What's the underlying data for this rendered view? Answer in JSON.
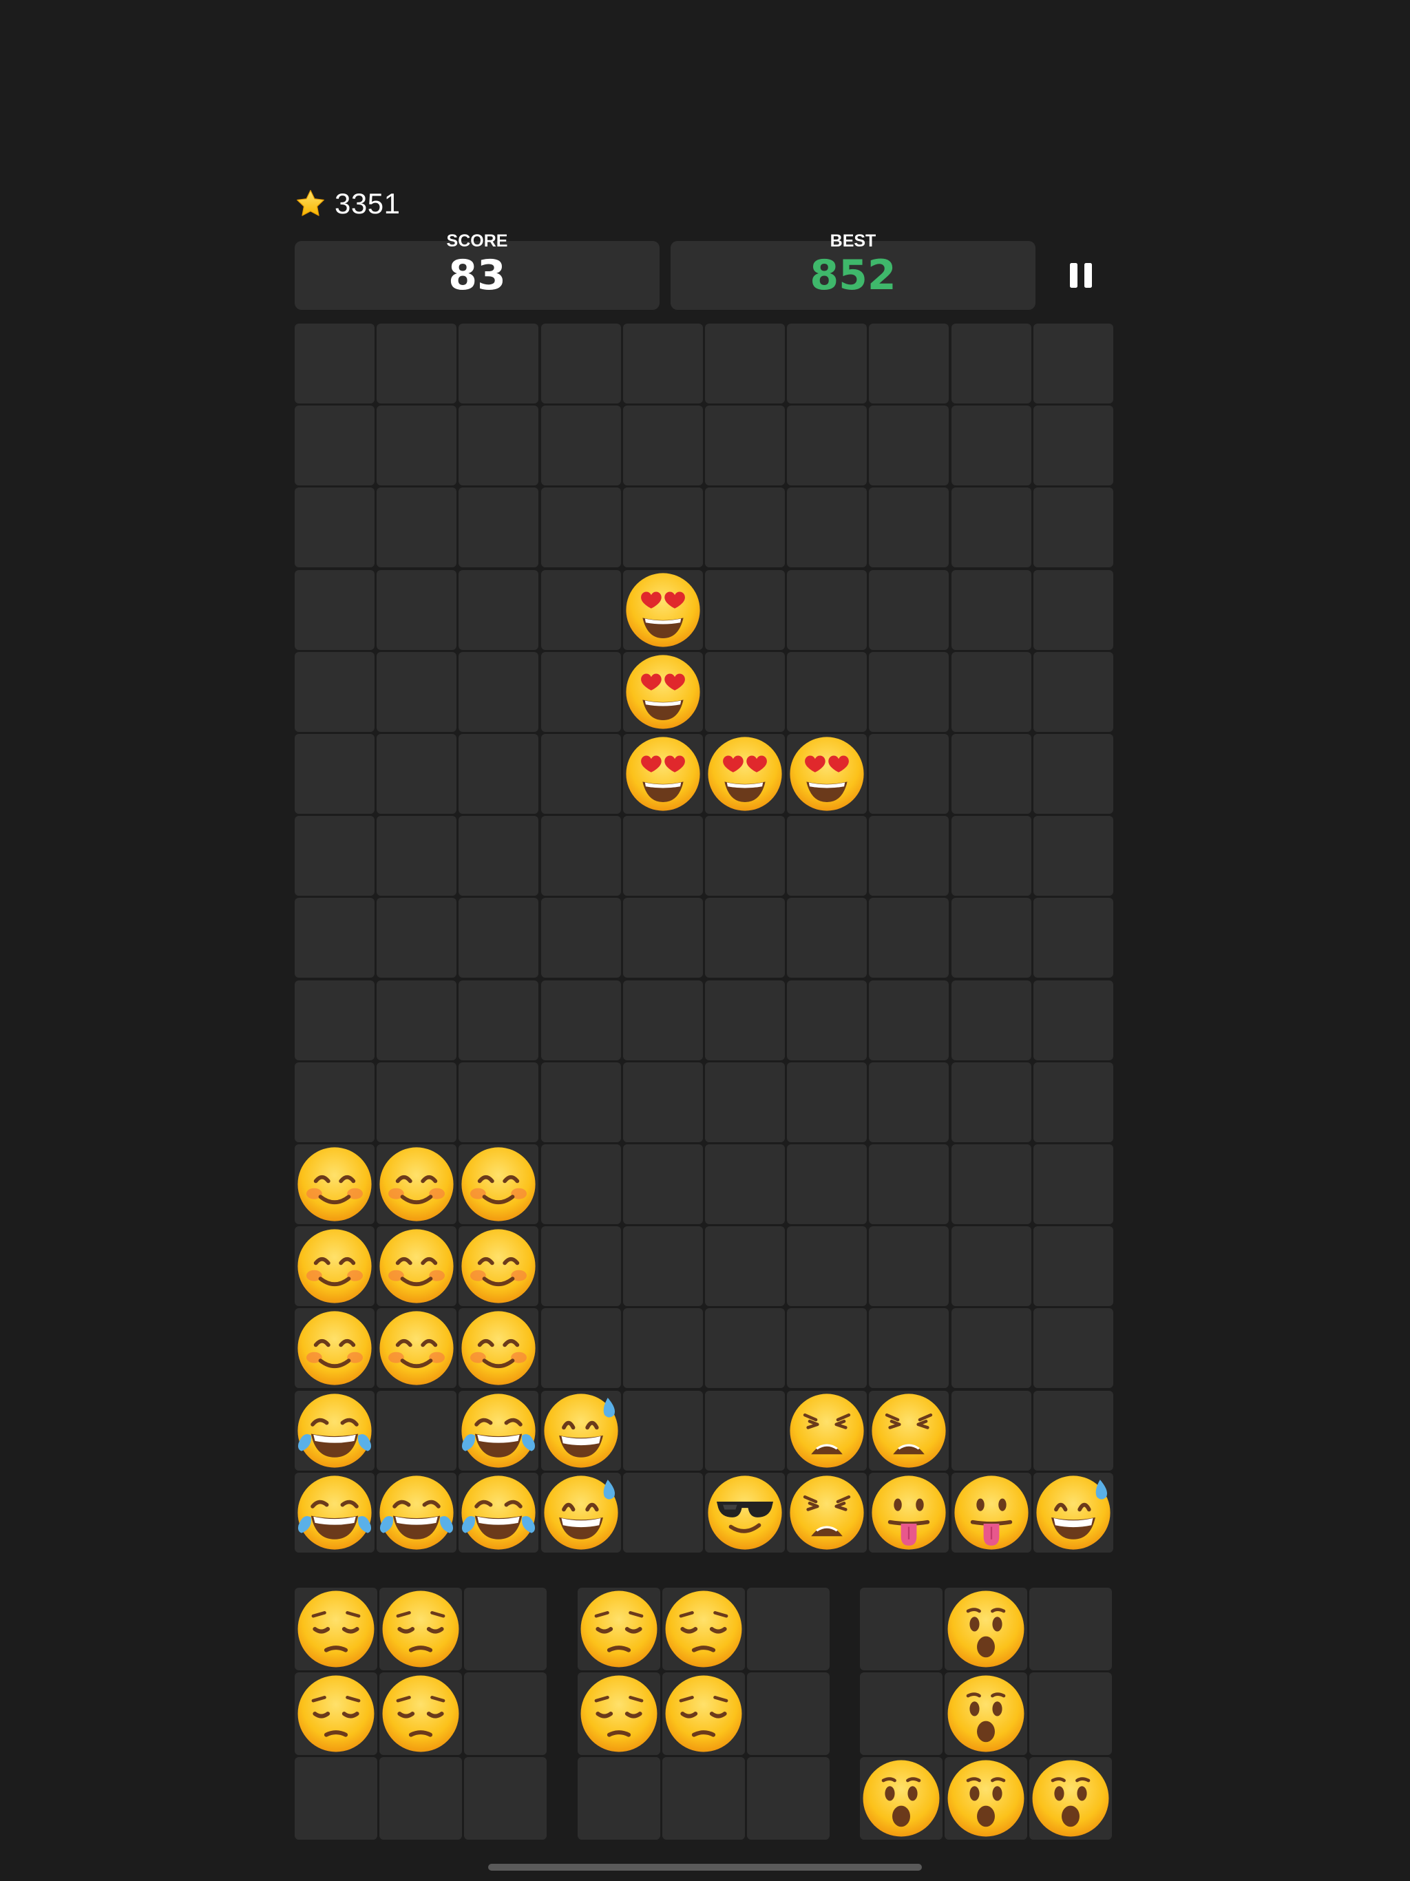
{
  "header": {
    "coins": {
      "icon": "star-icon",
      "value": "3351"
    },
    "score": {
      "label": "SCORE",
      "value": "83"
    },
    "best": {
      "label": "BEST",
      "value": "852"
    },
    "pause": {
      "icon": "pause-icon"
    }
  },
  "colors": {
    "background": "#1c1c1c",
    "cell": "#2f2f2f",
    "best_value": "#3fb86b"
  },
  "legend": {
    "H": "smiling-face-with-heart-eyes",
    "S": "smiling-face-with-smiling-eyes",
    "L": "face-with-tears-of-joy",
    "W": "grinning-face-with-sweat",
    "C": "smiling-face-with-sunglasses",
    "T": "weary-face",
    "P": "face-with-tongue",
    "D": "pensive-face",
    "O": "face-with-open-mouth"
  },
  "board": {
    "rows": 15,
    "cols": 10,
    "grid": [
      "..........",
      "..........",
      "..........",
      "....H.....",
      "....H.....",
      "....HHH...",
      "..........",
      "..........",
      "..........",
      "..........",
      "SSS.......",
      "SSS.......",
      "SSS.......",
      "L.LW..TT..",
      "LLLW.CTPPW"
    ]
  },
  "pieces": [
    {
      "grid": [
        "DD.",
        "DD.",
        "..."
      ]
    },
    {
      "grid": [
        "DD.",
        "DD.",
        "..."
      ]
    },
    {
      "grid": [
        ".O.",
        ".O.",
        "OOO"
      ]
    }
  ]
}
